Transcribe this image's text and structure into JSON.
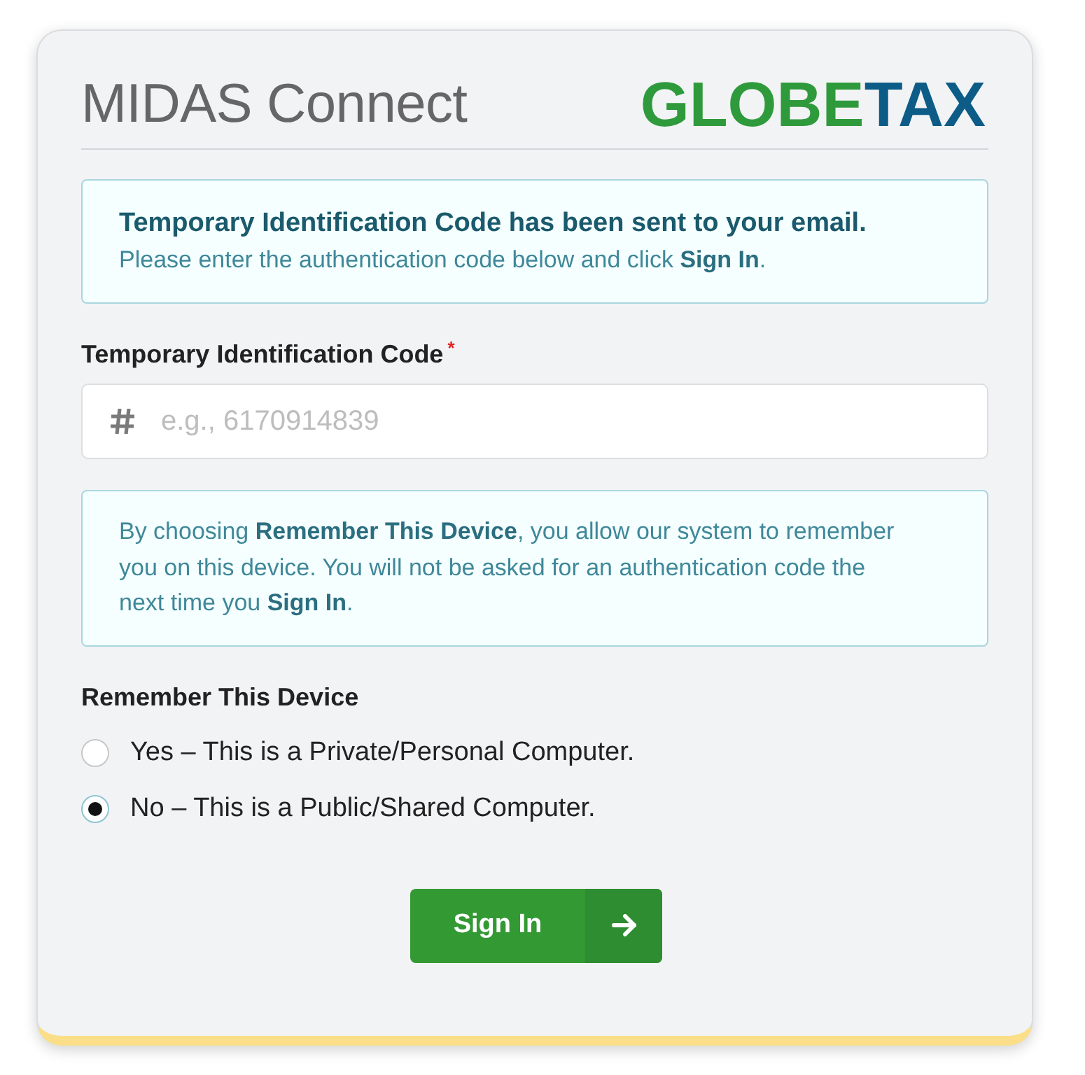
{
  "header": {
    "title": "MIDAS Connect",
    "logo": [
      {
        "text": "GLOBE",
        "color": "#2f9a3c"
      },
      {
        "text": "TAX",
        "color": "#0d5c87"
      }
    ]
  },
  "notice": {
    "heading": "Temporary Identification Code has been sent to your email.",
    "text": "Please enter the authentication code below and click **Sign In**."
  },
  "code_field": {
    "label": "Temporary Identification Code",
    "required_mark": "*",
    "placeholder": "e.g., 6170914839"
  },
  "info": {
    "text": "By choosing **Remember This Device**, you allow our system to remember you on this device. You will not be asked for an authentication code the next time you **Sign In**."
  },
  "remember": {
    "label": "Remember This Device",
    "options": [
      {
        "label": "Yes – This is a Private/Personal Computer.",
        "selected": false
      },
      {
        "label": "No – This is a Public/Shared Computer.",
        "selected": true
      }
    ]
  },
  "button": {
    "label": "Sign In"
  }
}
